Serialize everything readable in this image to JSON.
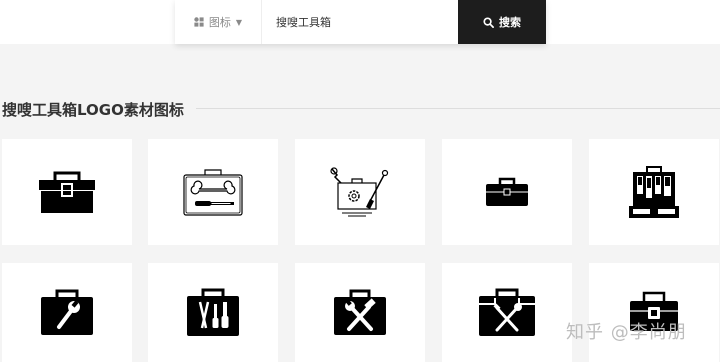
{
  "search": {
    "type_label": "图标",
    "query": "搜嗖工具箱",
    "button_label": "搜索"
  },
  "section": {
    "title": "搜嗖工具箱LOGO素材图标"
  },
  "icons": [
    {
      "name": "toolbox-icon"
    },
    {
      "name": "toolbox-wrench-screwdriver-outline-icon"
    },
    {
      "name": "toolbox-gear-tools-outline-icon"
    },
    {
      "name": "toolbox-small-icon"
    },
    {
      "name": "toolbox-tools-open-icon"
    },
    {
      "name": "toolbox-wrench-icon"
    },
    {
      "name": "toolbox-pliers-screwdriver-icon"
    },
    {
      "name": "toolbox-hammer-wrench-icon"
    },
    {
      "name": "toolbox-crossed-tools-icon"
    },
    {
      "name": "toolbox-padlock-icon"
    }
  ],
  "watermark": "知乎 @李尚朋"
}
